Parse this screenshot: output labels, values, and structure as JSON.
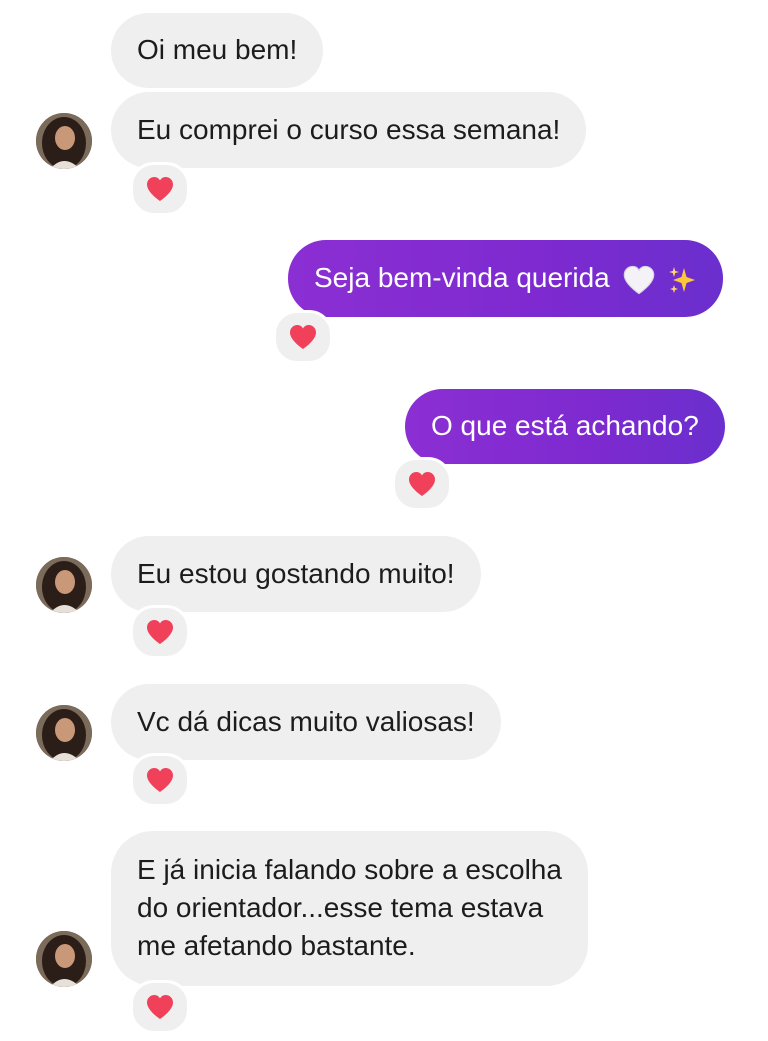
{
  "messages": [
    {
      "id": "m1",
      "direction": "incoming",
      "text": "Oi meu bem!"
    },
    {
      "id": "m2",
      "direction": "incoming",
      "text": "Eu comprei o curso essa semana!",
      "reaction": "red-heart-icon"
    },
    {
      "id": "m3",
      "direction": "outgoing",
      "text": "Seja bem-vinda querida",
      "emojis": [
        "white-heart-icon",
        "sparkles-icon"
      ],
      "reaction": "red-heart-icon"
    },
    {
      "id": "m4",
      "direction": "outgoing",
      "text": "O que está achando?",
      "reaction": "red-heart-icon"
    },
    {
      "id": "m5",
      "direction": "incoming",
      "text": "Eu estou gostando muito!",
      "reaction": "red-heart-icon"
    },
    {
      "id": "m6",
      "direction": "incoming",
      "text": "Vc dá dicas muito valiosas!",
      "reaction": "red-heart-icon"
    },
    {
      "id": "m7",
      "direction": "incoming",
      "lines": [
        "E já inicia falando sobre a escolha",
        "do orientador...esse tema estava",
        "me afetando bastante."
      ],
      "reaction": "red-heart-icon"
    }
  ],
  "colors": {
    "incoming_bubble": "#efefef",
    "outgoing_bubble_start": "#8b2fd3",
    "outgoing_bubble_end": "#6a2fce",
    "heart": "#f0405a",
    "text": "#1c1c1c"
  }
}
